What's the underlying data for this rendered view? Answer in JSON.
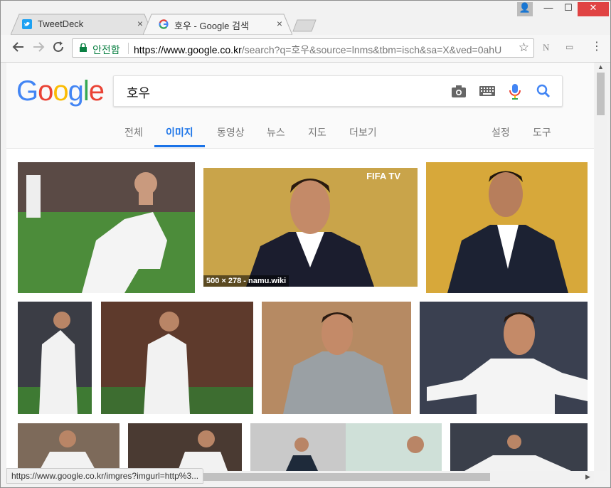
{
  "browser": {
    "tabs": [
      {
        "title": "TweetDeck",
        "close": "×"
      },
      {
        "title": "호우 - Google 검색",
        "close": "×"
      }
    ],
    "window_buttons": {
      "user": "👤",
      "minimize": "—",
      "maximize": "☐",
      "close": "✕"
    },
    "secure_label": "안전함",
    "url_host": "https://www.google.co.kr",
    "url_path": "/search?q=호우&source=lnms&tbm=isch&sa=X&ved=0ahU",
    "ext_labels": [
      "N",
      "▭"
    ],
    "status_url": "https://www.google.co.kr/imgres?imgurl=http%3..."
  },
  "google": {
    "logo": [
      "G",
      "o",
      "o",
      "g",
      "l",
      "e"
    ],
    "logo_colors": [
      "#4285F4",
      "#EA4335",
      "#FBBC05",
      "#4285F4",
      "#34A853",
      "#EA4335"
    ],
    "query": "호우",
    "nav": [
      "전체",
      "이미지",
      "동영상",
      "뉴스",
      "지도",
      "더보기"
    ],
    "nav_right": [
      "설정",
      "도구"
    ],
    "active_tab": "이미지"
  },
  "images": {
    "caption_1": "500 × 278 - namu.wiki",
    "fifa": "FIFA TV"
  },
  "colors": {
    "accent": "#1a73e8",
    "secure": "#0b8043",
    "close_btn": "#e04343"
  }
}
